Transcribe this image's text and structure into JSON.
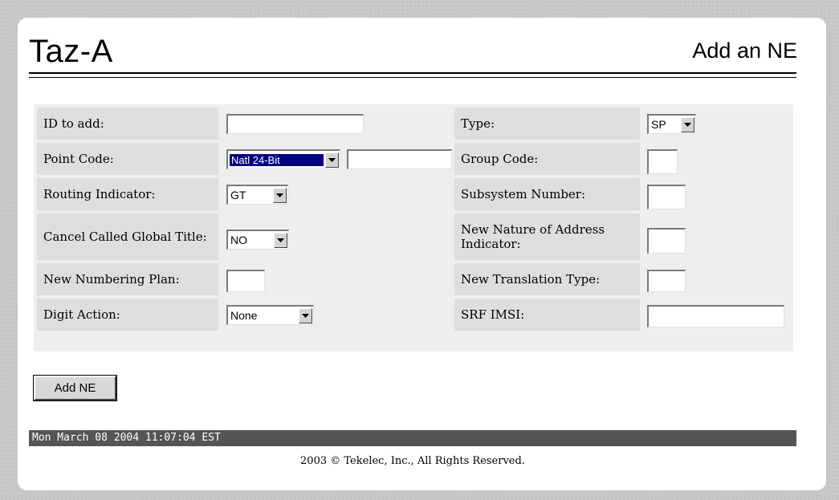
{
  "header": {
    "app_title": "Taz-A",
    "page_heading": "Add an NE"
  },
  "form": {
    "id_to_add": {
      "label": "ID to add:",
      "value": ""
    },
    "type": {
      "label": "Type:",
      "selected": "SP"
    },
    "point_code": {
      "label": "Point Code:",
      "format_selected": "Natl 24-Bit",
      "value": ""
    },
    "group_code": {
      "label": "Group Code:",
      "value": ""
    },
    "routing_indicator": {
      "label": "Routing Indicator:",
      "selected": "GT"
    },
    "subsystem_number": {
      "label": "Subsystem Number:",
      "value": ""
    },
    "cancel_called_global_title": {
      "label": "Cancel Called Global Title:",
      "selected": "NO"
    },
    "new_nature_of_address_indicator": {
      "label": "New Nature of Address Indicator:",
      "value": ""
    },
    "new_numbering_plan": {
      "label": "New Numbering Plan:",
      "value": ""
    },
    "new_translation_type": {
      "label": "New Translation Type:",
      "value": ""
    },
    "digit_action": {
      "label": "Digit Action:",
      "selected": "None"
    },
    "srf_imsi": {
      "label": "SRF IMSI:",
      "value": ""
    }
  },
  "actions": {
    "add_ne_label": "Add NE"
  },
  "footer": {
    "timestamp": "Mon March 08 2004 11:07:04 EST",
    "copyright": "2003 © Tekelec, Inc., All Rights Reserved."
  },
  "icons": {
    "dropdown": "triangle-down-icon"
  },
  "colors": {
    "status_bar": "#555555",
    "selection_highlight": "#000080",
    "label_cell": "#dedede",
    "form_panel": "#eeeeee"
  }
}
